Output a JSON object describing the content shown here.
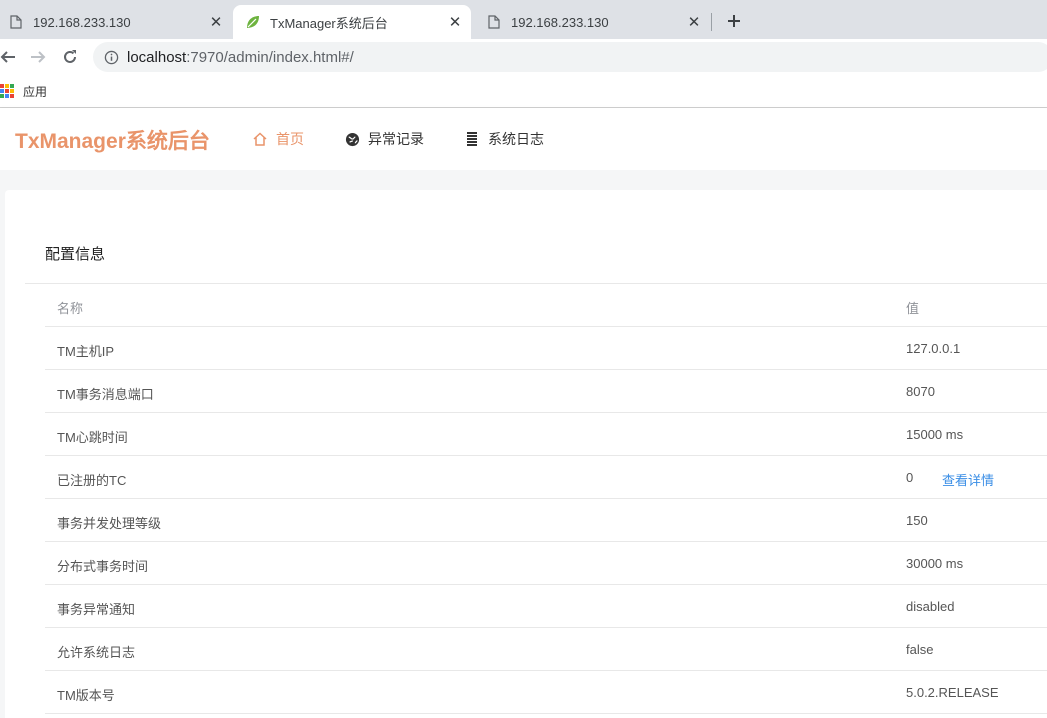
{
  "browser": {
    "tabs": [
      {
        "title": "192.168.233.130",
        "active": false
      },
      {
        "title": "TxManager系统后台",
        "active": true
      },
      {
        "title": "192.168.233.130",
        "active": false
      }
    ],
    "new_tab_icon": "plus-icon",
    "url_host": "localhost",
    "url_rest": ":7970/admin/index.html#/",
    "bookmarks": [
      {
        "label": "应用",
        "icon": "apps-grid-icon"
      }
    ]
  },
  "app": {
    "brand": "TxManager系统后台",
    "accent_color": "#e9946a",
    "nav": [
      {
        "label": "首页",
        "icon": "home-icon",
        "active": true
      },
      {
        "label": "异常记录",
        "icon": "globe-icon",
        "active": false
      },
      {
        "label": "系统日志",
        "icon": "list-icon",
        "active": false
      }
    ]
  },
  "config": {
    "title": "配置信息",
    "headers": {
      "name": "名称",
      "value": "值"
    },
    "rows": [
      {
        "name": "TM主机IP",
        "value": "127.0.0.1"
      },
      {
        "name": "TM事务消息端口",
        "value": "8070"
      },
      {
        "name": "TM心跳时间",
        "value": "15000 ms"
      },
      {
        "name": "已注册的TC",
        "value": "0",
        "link": "查看详情"
      },
      {
        "name": "事务并发处理等级",
        "value": "150"
      },
      {
        "name": "分布式事务时间",
        "value": "30000 ms"
      },
      {
        "name": "事务异常通知",
        "value": "disabled"
      },
      {
        "name": "允许系统日志",
        "value": "false"
      },
      {
        "name": "TM版本号",
        "value": "5.0.2.RELEASE"
      }
    ]
  }
}
